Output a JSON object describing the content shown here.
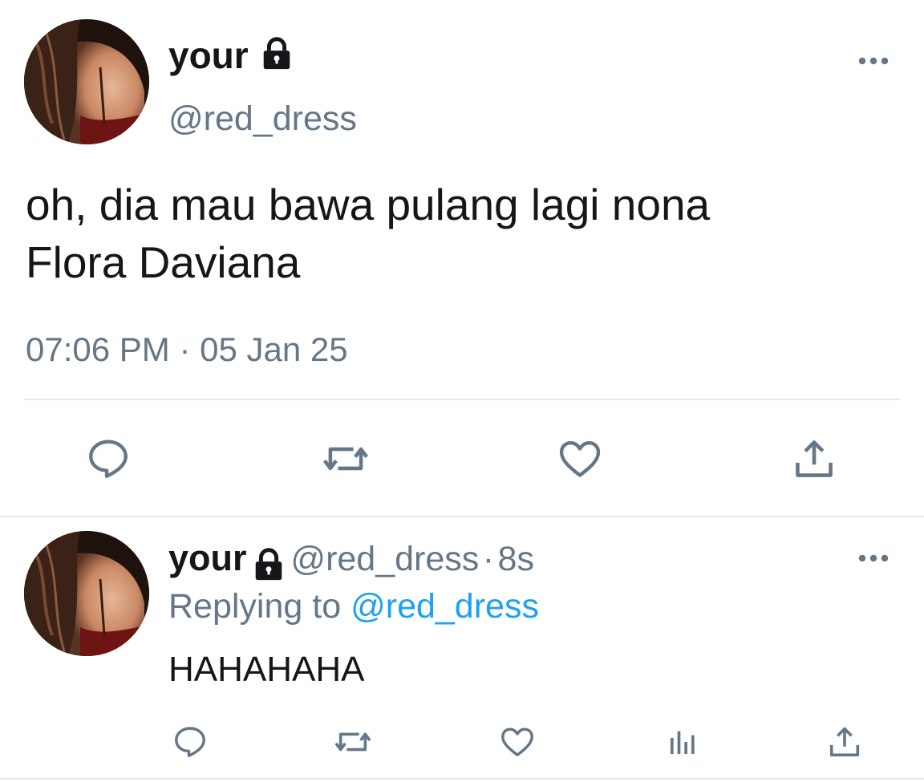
{
  "main_tweet": {
    "display_name": "your",
    "handle": "@red_dress",
    "text_line1": "oh, dia mau bawa pulang lagi nona",
    "text_line2": "Flora Daviana",
    "timestamp": "07:06 PM · 05 Jan 25",
    "actions": [
      "reply-icon",
      "retweet-icon",
      "like-icon",
      "share-icon"
    ]
  },
  "reply_tweet": {
    "display_name": "your",
    "handle": "@red_dress",
    "separator": "·",
    "age": "8s",
    "replying_prefix": "Replying to",
    "replying_to": "@red_dress",
    "text": "HAHAHAHA",
    "actions": [
      "reply-icon",
      "retweet-icon",
      "like-icon",
      "analytics-icon",
      "share-icon"
    ]
  },
  "colors": {
    "text": "#14171a",
    "muted": "#657786",
    "link": "#1da1f2",
    "divider": "#e1e8ed"
  }
}
